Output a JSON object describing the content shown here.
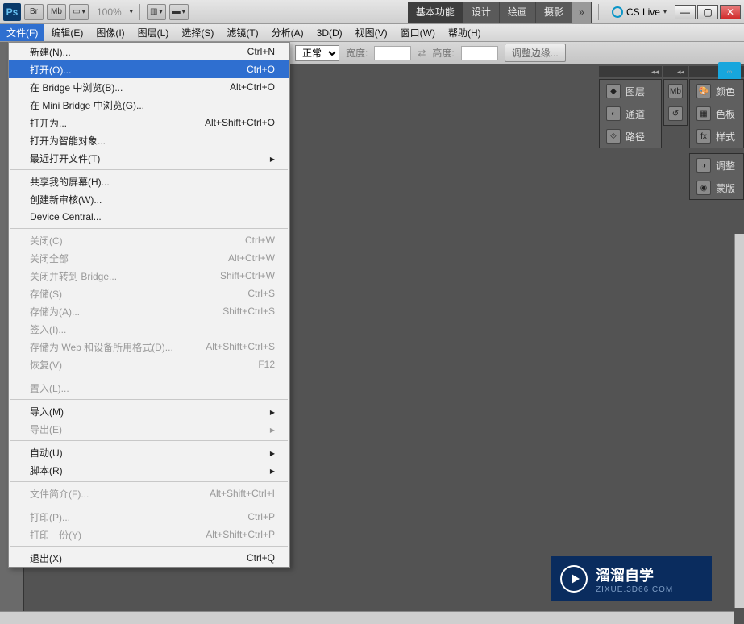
{
  "toolbar": {
    "ps_label": "Ps",
    "br_label": "Br",
    "mb_label": "Mb",
    "zoom": "100%",
    "cslive": "CS Live"
  },
  "workspace": {
    "tabs": [
      "基本功能",
      "设计",
      "绘画",
      "摄影"
    ],
    "more": "»"
  },
  "menubar": [
    "文件(F)",
    "编辑(E)",
    "图像(I)",
    "图层(L)",
    "选择(S)",
    "滤镜(T)",
    "分析(A)",
    "3D(D)",
    "视图(V)",
    "窗口(W)",
    "帮助(H)"
  ],
  "options": {
    "mode": "正常",
    "width_label": "宽度:",
    "height_label": "高度:",
    "refine": "调整边缘..."
  },
  "file_menu": {
    "groups": [
      [
        {
          "label": "新建(N)...",
          "shortcut": "Ctrl+N"
        },
        {
          "label": "打开(O)...",
          "shortcut": "Ctrl+O",
          "hl": true
        },
        {
          "label": "在 Bridge 中浏览(B)...",
          "shortcut": "Alt+Ctrl+O"
        },
        {
          "label": "在 Mini Bridge 中浏览(G)..."
        },
        {
          "label": "打开为...",
          "shortcut": "Alt+Shift+Ctrl+O"
        },
        {
          "label": "打开为智能对象..."
        },
        {
          "label": "最近打开文件(T)",
          "sub": true
        }
      ],
      [
        {
          "label": "共享我的屏幕(H)..."
        },
        {
          "label": "创建新审核(W)..."
        },
        {
          "label": "Device Central..."
        }
      ],
      [
        {
          "label": "关闭(C)",
          "shortcut": "Ctrl+W",
          "disabled": true
        },
        {
          "label": "关闭全部",
          "shortcut": "Alt+Ctrl+W",
          "disabled": true
        },
        {
          "label": "关闭并转到 Bridge...",
          "shortcut": "Shift+Ctrl+W",
          "disabled": true
        },
        {
          "label": "存储(S)",
          "shortcut": "Ctrl+S",
          "disabled": true
        },
        {
          "label": "存储为(A)...",
          "shortcut": "Shift+Ctrl+S",
          "disabled": true
        },
        {
          "label": "签入(I)...",
          "disabled": true
        },
        {
          "label": "存储为 Web 和设备所用格式(D)...",
          "shortcut": "Alt+Shift+Ctrl+S",
          "disabled": true
        },
        {
          "label": "恢复(V)",
          "shortcut": "F12",
          "disabled": true
        }
      ],
      [
        {
          "label": "置入(L)...",
          "disabled": true
        }
      ],
      [
        {
          "label": "导入(M)",
          "sub": true
        },
        {
          "label": "导出(E)",
          "sub": true,
          "disabled": true
        }
      ],
      [
        {
          "label": "自动(U)",
          "sub": true
        },
        {
          "label": "脚本(R)",
          "sub": true
        }
      ],
      [
        {
          "label": "文件简介(F)...",
          "shortcut": "Alt+Shift+Ctrl+I",
          "disabled": true
        }
      ],
      [
        {
          "label": "打印(P)...",
          "shortcut": "Ctrl+P",
          "disabled": true
        },
        {
          "label": "打印一份(Y)",
          "shortcut": "Alt+Shift+Ctrl+P",
          "disabled": true
        }
      ],
      [
        {
          "label": "退出(X)",
          "shortcut": "Ctrl+Q"
        }
      ]
    ]
  },
  "panels": {
    "left": [
      "图层",
      "通道",
      "路径"
    ],
    "right": [
      "颜色",
      "色板",
      "样式"
    ],
    "right2": [
      "调整",
      "蒙版"
    ],
    "mini_mb": "Mb"
  },
  "watermark": {
    "big": "溜溜自学",
    "small": "ZIXUE.3D66.COM"
  }
}
